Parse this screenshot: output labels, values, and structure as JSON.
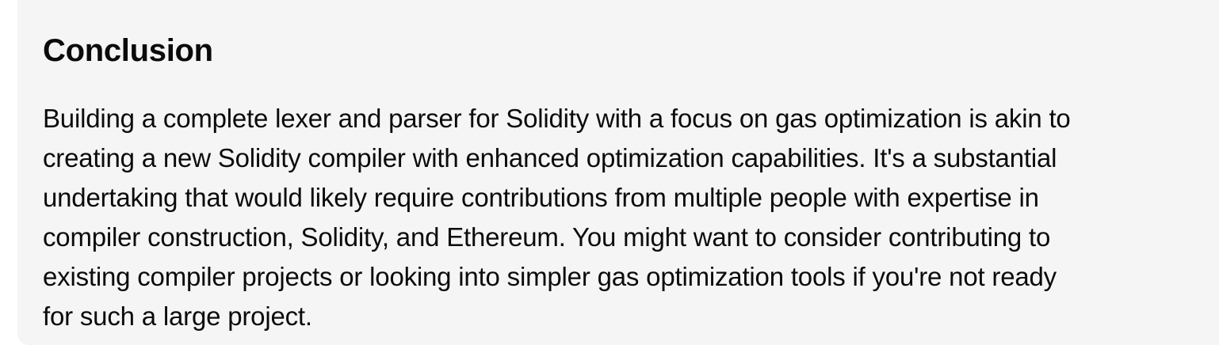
{
  "section": {
    "heading": "Conclusion",
    "paragraph_lines": [
      "Building a complete lexer and parser for Solidity with a focus on gas optimization is akin to",
      "creating a new Solidity compiler with enhanced optimization capabilities. It's a substantial",
      "undertaking that would likely require contributions from multiple people with expertise in",
      "compiler construction, Solidity, and Ethereum. You might want to consider contributing to",
      "existing compiler projects or looking into simpler gas optimization tools if you're not ready",
      "for such a large project."
    ]
  },
  "colors": {
    "panel_background": "#f5f5f5",
    "text": "#0b0b0b"
  }
}
